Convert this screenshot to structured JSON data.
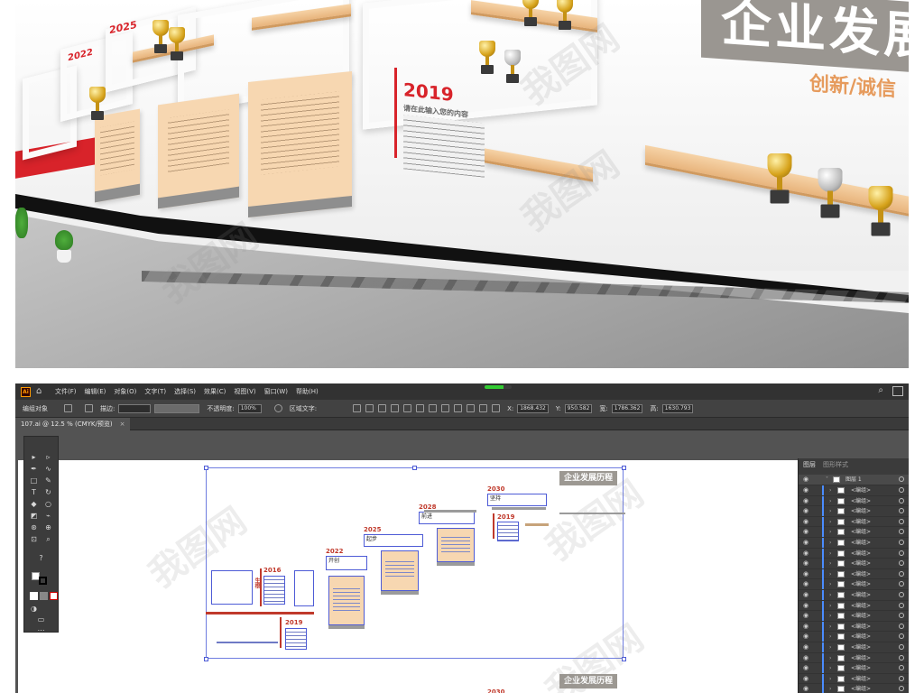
{
  "render": {
    "title": "企业发展",
    "subtitle": "创新/诚信",
    "years": [
      "2025",
      "2022",
      "2019"
    ],
    "panel_heading": "请在此输入您的内容"
  },
  "app": {
    "logo": "Ai",
    "menu": [
      "文件(F)",
      "编辑(E)",
      "对象(O)",
      "文字(T)",
      "选择(S)",
      "效果(C)",
      "视图(V)",
      "窗口(W)",
      "帮助(H)"
    ],
    "progress_percent": 70,
    "control": {
      "selection_label": "编组对象",
      "stroke_label": "描边:",
      "opacity_label": "不透明度:",
      "opacity_value": "100%",
      "style_label": "区域文字:",
      "x_label": "X:",
      "x_value": "1868.432",
      "y_label": "Y:",
      "y_value": "950.582",
      "w_label": "宽:",
      "w_value": "1786.362",
      "h_label": "高:",
      "h_value": "1630.793"
    },
    "document_tab": "107.ai @ 12.5 % (CMYK/预览)",
    "layers_panel": {
      "tabs": [
        "图层",
        "图形样式"
      ],
      "top_layer": "图层 1",
      "item_label": "<编组>",
      "item_count": 20
    },
    "artboard": {
      "title": "企业发展历程",
      "years": [
        "2016",
        "2019",
        "2022",
        "2025",
        "2028",
        "2030",
        "2019"
      ],
      "stage_labels": [
        "开创",
        "起步",
        "前进",
        "坚持"
      ],
      "vertical_label": "生根",
      "bottom_title": "企业发展历程",
      "bottom_year": "2030"
    }
  },
  "watermark": "我图网"
}
